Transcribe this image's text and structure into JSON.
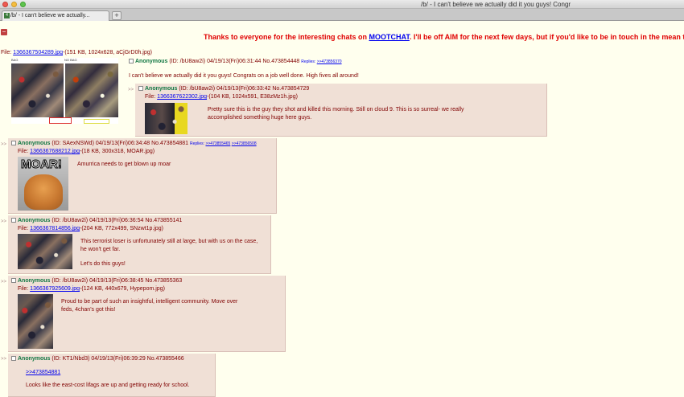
{
  "window": {
    "title": "/b/ - I can't believe we actually did it you guys! Congr",
    "tab_title": "/b/ - I can't believe we actually..."
  },
  "banner": {
    "before": "Thanks to everyone for the interesting chats on ",
    "link": "MOOTCHAT",
    "after": ". I'll be off AIM for the next few days, but if you'd like to be in touch in the mean time, fee"
  },
  "op": {
    "file_prefix": "File: ",
    "file_link": "1366367504289.jpg",
    "file_info": "-(151 KB, 1024x628, aCjGrD0h.jpg)",
    "name": "Anonymous",
    "meta": " (ID: /bU8aw2i) 04/19/13(Fri)06:31:44 No.473854448",
    "replies_label": "Replies:",
    "replies_link": ">>473856370",
    "thumb_label_left": "BAG",
    "thumb_label_right": "NO BAG",
    "body": "I can't believe we actually did it you guys! Congrats on a job well done. High fives all around!"
  },
  "posts": [
    {
      "name": "Anonymous",
      "meta": " (ID: /bU8aw2i) 04/19/13(Fri)06:33:42 No.473854729",
      "file_prefix": "File: ",
      "file_link": "1366367622302.jpg",
      "file_info": "-(104 KB, 1024x591, E38zMz1h.jpg)",
      "body": "Pretty sure this is the guy they shot and killed this morning. Still on cloud 9. This is so surreal- we really accomplished something huge here guys."
    },
    {
      "name": "Anonymous",
      "meta": " (ID: SAexNSWd) 04/19/13(Fri)06:34:48 No.473854881",
      "replies_label": "Replies:",
      "replies_1": ">>473855465",
      "replies_2": ">>473856508",
      "file_prefix": "File: ",
      "file_link": "1366367688212.jpg",
      "file_info": "-(18 KB, 300x318, MOAR.jpg)",
      "thumb_text": "MOAR!",
      "body": "Amurrica needs to get blown up moar"
    },
    {
      "name": "Anonymous",
      "meta": " (ID: /bU8aw2i) 04/19/13(Fri)06:36:54 No.473855141",
      "file_prefix": "File: ",
      "file_link": "1366367814856.jpg",
      "file_info": "-(204 KB, 772x499, SNzwt1p.jpg)",
      "body_1": "This terrorist loser is unfortunately still at large, but with us on the case, he won't get far.",
      "body_2": "Let's do this guys!"
    },
    {
      "name": "Anonymous",
      "meta": " (ID: /bU8aw2i) 04/19/13(Fri)06:38:45 No.473855363",
      "file_prefix": "File: ",
      "file_link": "1366367925609.jpg",
      "file_info": "-(124 KB, 440x679, Hypepom.jpg)",
      "body": "Proud to be part of such an insightful, intelligent community. Move over feds, 4chan's got this!"
    },
    {
      "name": "Anonymous",
      "meta": " (ID: KT1/Nbd3) 04/19/13(Fri)06:39:29 No.473855466",
      "quote": ">>473854881",
      "body": "Looks like the east-cost lifags are up and getting ready for school."
    }
  ],
  "colors": {
    "post_bg": "#f0e0d6",
    "page_bg": "#ffffee",
    "name": "#117743",
    "text": "#800000",
    "banner": "#e00000",
    "link": "#0000ee"
  }
}
